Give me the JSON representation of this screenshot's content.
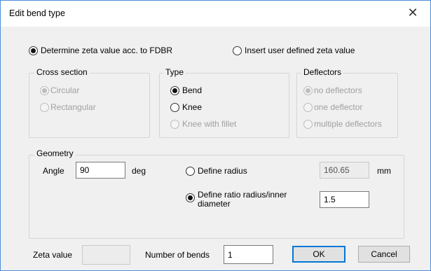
{
  "window": {
    "title": "Edit bend type",
    "close_glyph": "✕"
  },
  "mode": {
    "fdbr_label": "Determine zeta value acc. to FDBR",
    "user_label": "Insert user defined zeta value",
    "selected": "fdbr"
  },
  "cross_section": {
    "legend": "Cross section",
    "options": [
      "Circular",
      "Rectangular"
    ],
    "selected_index": 0,
    "disabled": true
  },
  "type": {
    "legend": "Type",
    "options": [
      "Bend",
      "Knee",
      "Knee with fillet"
    ],
    "selected_index": 0
  },
  "deflectors": {
    "legend": "Deflectors",
    "options": [
      "no deflectors",
      "one deflector",
      "multiple deflectors"
    ],
    "selected_index": 0,
    "disabled": true
  },
  "geometry": {
    "legend": "Geometry",
    "angle_label": "Angle",
    "angle_value": "90",
    "angle_unit": "deg",
    "define_radius_label": "Define radius",
    "radius_value": "160.65",
    "radius_unit": "mm",
    "ratio_label_line1": "Define ratio radius/inner",
    "ratio_label_line2": "diameter",
    "ratio_value": "1.5",
    "selected": "ratio"
  },
  "footer": {
    "zeta_label": "Zeta value",
    "zeta_value": "",
    "bends_label": "Number of bends",
    "bends_value": "1",
    "ok_label": "OK",
    "cancel_label": "Cancel"
  }
}
